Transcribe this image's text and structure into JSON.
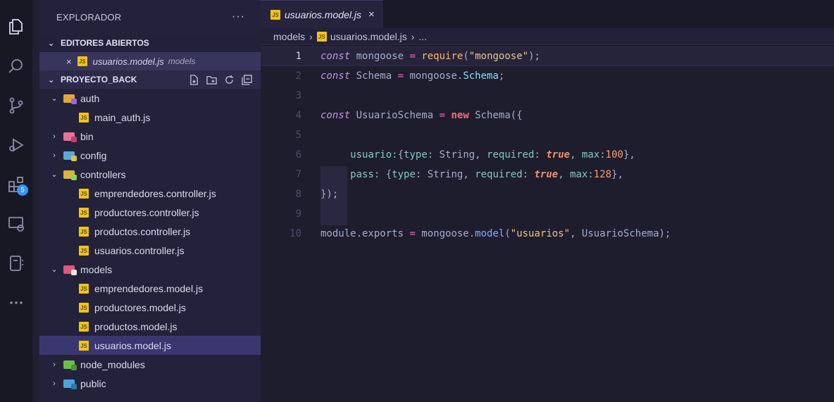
{
  "explorer": {
    "title": "EXPLORADOR",
    "more": "···",
    "open_editors_label": "EDITORES ABIERTOS",
    "open_editor": {
      "close": "×",
      "name": "usuarios.model.js",
      "folder": "models"
    },
    "project_label": "PROYECTO_BACK",
    "project_actions": [
      "new-file-icon",
      "new-folder-icon",
      "refresh-icon",
      "collapse-icon"
    ],
    "tree": [
      {
        "label": "auth",
        "type": "folder",
        "chev": "⌄",
        "indent": 1,
        "icon": "f-auth"
      },
      {
        "label": "main_auth.js",
        "type": "file",
        "indent": 2
      },
      {
        "label": "bin",
        "type": "folder",
        "chev": "›",
        "indent": 1,
        "icon": "f-bin"
      },
      {
        "label": "config",
        "type": "folder",
        "chev": "›",
        "indent": 1,
        "icon": "f-config"
      },
      {
        "label": "controllers",
        "type": "folder",
        "chev": "⌄",
        "indent": 1,
        "icon": "f-ctrl"
      },
      {
        "label": "emprendedores.controller.js",
        "type": "file",
        "indent": 2
      },
      {
        "label": "productores.controller.js",
        "type": "file",
        "indent": 2
      },
      {
        "label": "productos.controller.js",
        "type": "file",
        "indent": 2
      },
      {
        "label": "usuarios.controller.js",
        "type": "file",
        "indent": 2
      },
      {
        "label": "models",
        "type": "folder",
        "chev": "⌄",
        "indent": 1,
        "icon": "f-models"
      },
      {
        "label": "emprendedores.model.js",
        "type": "file",
        "indent": 2
      },
      {
        "label": "productores.model.js",
        "type": "file",
        "indent": 2
      },
      {
        "label": "productos.model.js",
        "type": "file",
        "indent": 2
      },
      {
        "label": "usuarios.model.js",
        "type": "file",
        "indent": 2,
        "selected": true
      },
      {
        "label": "node_modules",
        "type": "folder",
        "chev": "›",
        "indent": 1,
        "icon": "f-node"
      },
      {
        "label": "public",
        "type": "folder",
        "chev": "›",
        "indent": 1,
        "icon": "f-public"
      }
    ]
  },
  "activity": {
    "badge": "5"
  },
  "editor": {
    "tab": {
      "label": "usuarios.model.js",
      "close": "×"
    },
    "breadcrumb": {
      "folder": "models",
      "sep": "›",
      "file": "usuarios.model.js",
      "more": "..."
    },
    "active_line": 1,
    "lines": [
      {
        "n": "1",
        "tokens": [
          [
            "ki",
            "const"
          ],
          [
            "p",
            " mongoose "
          ],
          [
            "k",
            "="
          ],
          [
            "p",
            " "
          ],
          [
            "f",
            "require"
          ],
          [
            "p",
            "("
          ],
          [
            "s",
            "\"mongoose\""
          ],
          [
            "p",
            ");"
          ]
        ]
      },
      {
        "n": "2",
        "tokens": [
          [
            "ki",
            "const"
          ],
          [
            "p",
            " Schema "
          ],
          [
            "k",
            "="
          ],
          [
            "p",
            " mongoose."
          ],
          [
            "ty",
            "Schema"
          ],
          [
            "p",
            ";"
          ]
        ]
      },
      {
        "n": "3",
        "tokens": []
      },
      {
        "n": "4",
        "tokens": [
          [
            "ki",
            "const"
          ],
          [
            "p",
            " UsuarioSchema "
          ],
          [
            "k",
            "="
          ],
          [
            "p",
            " "
          ],
          [
            "kn",
            "new"
          ],
          [
            "p",
            " Schema({"
          ]
        ]
      },
      {
        "n": "5",
        "tokens": []
      },
      {
        "n": "6",
        "tokens": [
          [
            "p",
            "     "
          ],
          [
            "prop",
            "usuario"
          ],
          [
            "p",
            ":{"
          ],
          [
            "prop",
            "type"
          ],
          [
            "p",
            ": String, "
          ],
          [
            "prop",
            "required"
          ],
          [
            "p",
            ": "
          ],
          [
            "bt",
            "true"
          ],
          [
            "p",
            ", "
          ],
          [
            "prop",
            "max"
          ],
          [
            "p",
            ":"
          ],
          [
            "num",
            "100"
          ],
          [
            "p",
            "},"
          ]
        ]
      },
      {
        "n": "7",
        "tokens": [
          [
            "p",
            "     "
          ],
          [
            "prop",
            "pass"
          ],
          [
            "p",
            ": {"
          ],
          [
            "prop",
            "type"
          ],
          [
            "p",
            ": String, "
          ],
          [
            "prop",
            "required"
          ],
          [
            "p",
            ": "
          ],
          [
            "bt",
            "true"
          ],
          [
            "p",
            ", "
          ],
          [
            "prop",
            "max"
          ],
          [
            "p",
            ":"
          ],
          [
            "num",
            "128"
          ],
          [
            "p",
            "},"
          ]
        ]
      },
      {
        "n": "8",
        "tokens": [
          [
            "p",
            "});"
          ]
        ]
      },
      {
        "n": "9",
        "tokens": []
      },
      {
        "n": "10",
        "tokens": [
          [
            "p",
            "module.exports "
          ],
          [
            "k",
            "="
          ],
          [
            "p",
            " mongoose."
          ],
          [
            "cl",
            "model"
          ],
          [
            "p",
            "("
          ],
          [
            "s",
            "\"usuarios\""
          ],
          [
            "p",
            ", UsuarioSchema);"
          ]
        ]
      }
    ]
  },
  "colors": {
    "accent": "#3794ff",
    "sidebar": "#24223a",
    "editor_bg": "#1e1d2d",
    "selection": "#3a3770"
  }
}
